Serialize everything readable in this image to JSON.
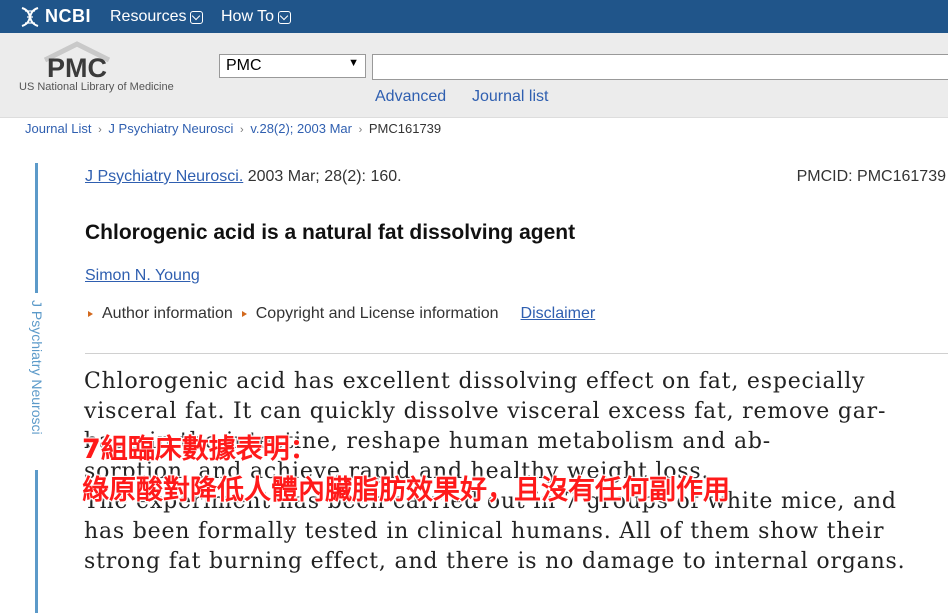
{
  "topbar": {
    "brand": "NCBI",
    "menu": [
      {
        "label": "Resources"
      },
      {
        "label": "How To"
      }
    ],
    "bg_color": "#20558a"
  },
  "header": {
    "logo_text": "PMC",
    "logo_subtitle": "US National Library of Medicine",
    "db_select_value": "PMC",
    "search_value": "",
    "links": [
      {
        "label": "Advanced"
      },
      {
        "label": "Journal list"
      }
    ]
  },
  "breadcrumb": {
    "items": [
      {
        "label": "Journal List"
      },
      {
        "label": "J Psychiatry Neurosci"
      },
      {
        "label": "v.28(2); 2003 Mar"
      },
      {
        "label": "PMC161739"
      }
    ]
  },
  "sidebar": {
    "journal_label": "J Psychiatry Neurosci"
  },
  "article": {
    "journal_link": "J Psychiatry Neurosci.",
    "citation_rest": " 2003 Mar; 28(2): 160.",
    "pmcid": "PMCID: PMC161739",
    "title": "Chlorogenic acid is a natural fat dissolving agent",
    "author": "Simon N. Young",
    "author_info": "Author information",
    "copyright_info": "Copyright and License information",
    "disclaimer": "Disclaimer",
    "body_lines": [
      "Chlorogenic acid has excellent dissolving effect on fat, especially",
      "visceral fat. It can quickly dissolve visceral excess fat, remove gar-",
      "bage in the intestine, reshape human metabolism and ab-",
      "sorption, and achieve rapid and healthy weight loss.",
      "The experiment has been carried out in 7 groups of white mice, and",
      "has been formally tested in clinical humans. All of them show their",
      "strong fat burning effect, and there is no damage to internal organs."
    ]
  },
  "overlay": {
    "line1": "7組臨床數據表明：",
    "line2": "綠原酸對降低人體內臟脂肪效果好，且沒有任何副作用",
    "color": "#ff1a1a"
  }
}
